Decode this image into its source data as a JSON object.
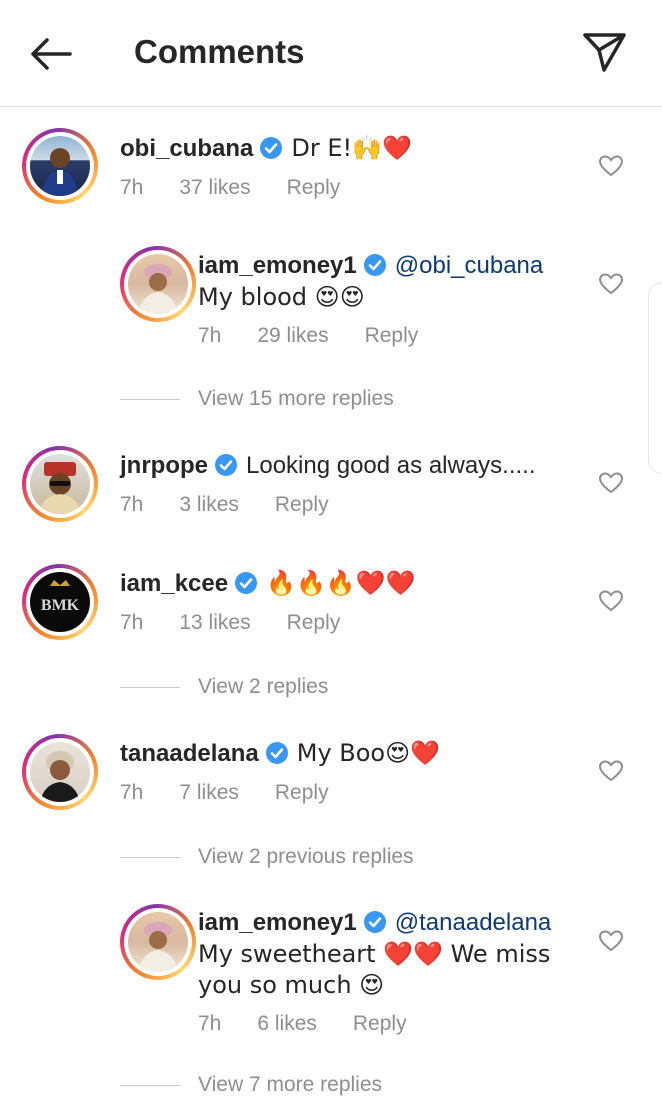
{
  "header": {
    "title": "Comments",
    "back_icon": "arrow-left-icon",
    "send_icon": "paper-plane-icon"
  },
  "comments": [
    {
      "username": "obi_cubana",
      "text": "Dr E!🙌❤️",
      "mention": "",
      "time": "7h",
      "likes": "37 likes",
      "reply": "Reply"
    },
    {
      "username": "iam_emoney1",
      "mention": "@obi_cubana",
      "text": "My blood 😍😍",
      "time": "7h",
      "likes": "29 likes",
      "reply": "Reply"
    },
    {
      "username": "jnrpope",
      "text": "Looking good as always.....",
      "mention": "",
      "time": "7h",
      "likes": "3 likes",
      "reply": "Reply"
    },
    {
      "username": "iam_kcee",
      "text": "🔥🔥🔥❤️❤️",
      "mention": "",
      "time": "7h",
      "likes": "13 likes",
      "reply": "Reply"
    },
    {
      "username": "tanaadelana",
      "text": "My Boo😍❤️",
      "mention": "",
      "time": "7h",
      "likes": "7 likes",
      "reply": "Reply"
    },
    {
      "username": "iam_emoney1",
      "mention": "@tanaadelana",
      "text_line1": "My sweetheart ❤️❤️ We miss",
      "text_line2": "you so much 😍",
      "time": "7h",
      "likes": "6 likes",
      "reply": "Reply"
    }
  ],
  "view_more": [
    "View 15 more replies",
    "View 2 replies",
    "View 2 previous replies",
    "View 7 more replies"
  ],
  "kcee_avatar_text": "BMK",
  "colors": {
    "verified": "#3897f0",
    "mention": "#0b3a74",
    "meta": "#8e8e8e"
  }
}
